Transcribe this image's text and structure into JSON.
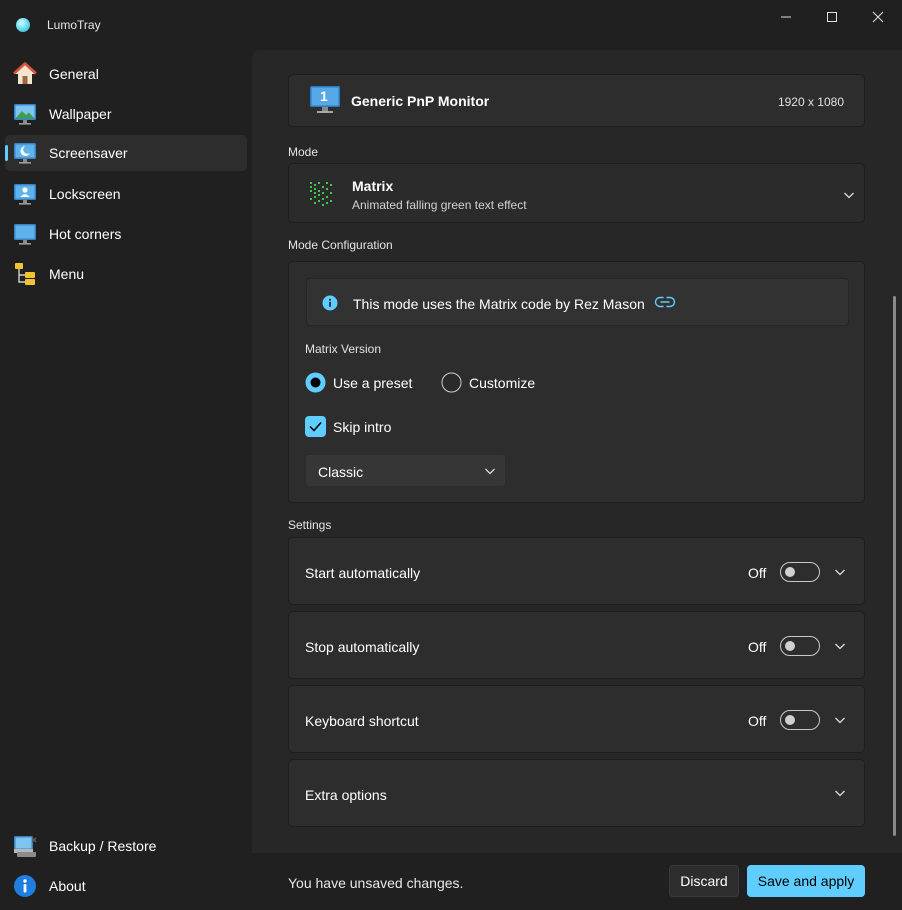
{
  "app": {
    "title": "LumoTray"
  },
  "window_controls": {
    "minimize_icon": "minimize-icon",
    "maximize_icon": "maximize-icon",
    "close_icon": "close-icon"
  },
  "sidebar": {
    "items": [
      {
        "label": "General",
        "icon": "home-icon",
        "active": false
      },
      {
        "label": "Wallpaper",
        "icon": "wallpaper-icon",
        "active": false
      },
      {
        "label": "Screensaver",
        "icon": "screensaver-icon",
        "active": true
      },
      {
        "label": "Lockscreen",
        "icon": "lockscreen-icon",
        "active": false
      },
      {
        "label": "Hot corners",
        "icon": "hot-corners-icon",
        "active": false
      },
      {
        "label": "Menu",
        "icon": "menu-icon",
        "active": false
      }
    ],
    "bottom_items": [
      {
        "label": "Backup / Restore",
        "icon": "backup-icon"
      },
      {
        "label": "About",
        "icon": "info-icon"
      }
    ]
  },
  "monitor": {
    "badge": "1",
    "name": "Generic PnP Monitor",
    "resolution": "1920 x 1080"
  },
  "mode": {
    "section_title": "Mode",
    "selected_name": "Matrix",
    "selected_description": "Animated falling green text effect"
  },
  "mode_config": {
    "section_title": "Mode Configuration",
    "info_text": "This mode uses the Matrix code by Rez Mason",
    "version_label": "Matrix Version",
    "radio_preset": "Use a preset",
    "radio_customize": "Customize",
    "selected_radio": "preset",
    "skip_intro_label": "Skip intro",
    "skip_intro_checked": true,
    "preset_value": "Classic"
  },
  "settings": {
    "section_title": "Settings",
    "rows": [
      {
        "label": "Start automatically",
        "state": "Off"
      },
      {
        "label": "Stop automatically",
        "state": "Off"
      },
      {
        "label": "Keyboard shortcut",
        "state": "Off"
      }
    ],
    "extra_label": "Extra options"
  },
  "footer": {
    "status": "You have unsaved changes.",
    "discard_label": "Discard",
    "save_label": "Save and apply"
  },
  "colors": {
    "accent": "#60cdff",
    "background": "#202020",
    "card": "#2d2d2d"
  }
}
